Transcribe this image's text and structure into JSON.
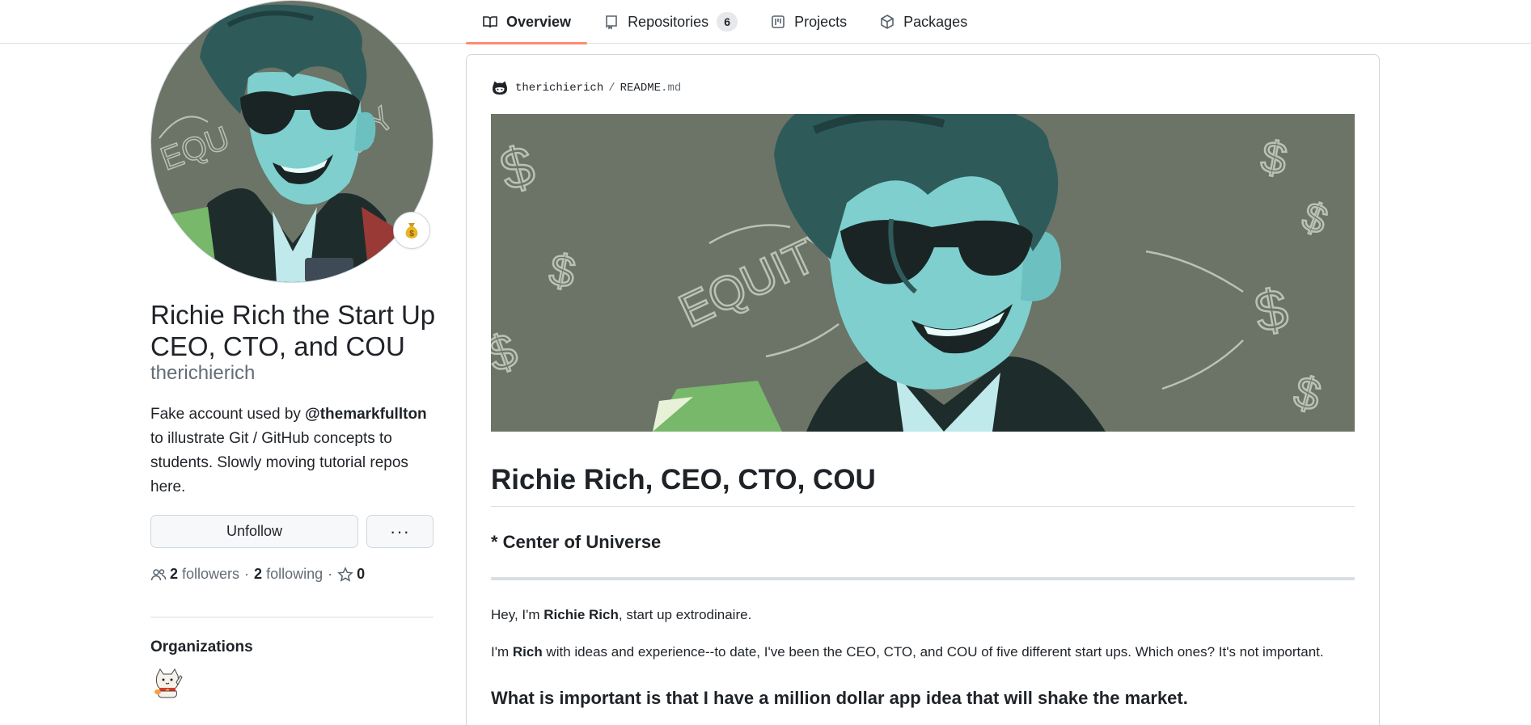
{
  "tabs": [
    {
      "label": "Overview",
      "icon": "book-icon",
      "active": true
    },
    {
      "label": "Repositories",
      "icon": "repo-icon",
      "count": "6"
    },
    {
      "label": "Projects",
      "icon": "project-icon"
    },
    {
      "label": "Packages",
      "icon": "package-icon"
    }
  ],
  "profile": {
    "full_name": "Richie Rich the Start Up CEO, CTO, and COU",
    "login": "therichierich",
    "status_emoji": "moneybag-icon",
    "bio_prefix": "Fake account used by ",
    "bio_mention": "@themarkfullton",
    "bio_suffix": " to illustrate Git / GitHub concepts to students. Slowly moving tutorial repos here.",
    "unfollow_label": "Unfollow",
    "more_label": "···",
    "followers_count": "2",
    "followers_label": "followers",
    "following_count": "2",
    "following_label": "following",
    "stars_count": "0",
    "separator": "·",
    "organizations_title": "Organizations"
  },
  "readme": {
    "owner": "therichierich",
    "separator": "/",
    "file_base": "README",
    "file_ext": ".md",
    "banner_text": "EQUITY",
    "heading": "Richie Rich, CEO, CTO, COU",
    "subheading": "* Center of Universe",
    "p1_a": "Hey, I'm ",
    "p1_b": "Richie Rich",
    "p1_c": ", start up extrodinaire.",
    "p2_a": "I'm ",
    "p2_b": "Rich",
    "p2_c": " with ideas and experience--to date, I've been the CEO, CTO, and COU of five different start ups. Which ones? It's not important.",
    "heading2": "What is important is that I have a million dollar app idea that will shake the market."
  },
  "colors": {
    "tab_underline": "#fd8c73",
    "banner_bg": "#6b7467",
    "skin": "#7fcfcf",
    "hair": "#2f5a5a"
  }
}
